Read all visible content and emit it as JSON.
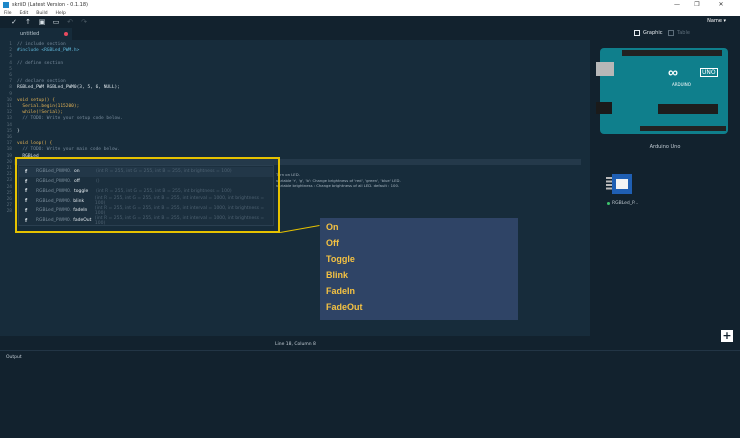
{
  "window": {
    "title": "skriiD (Latest Version - 0.1.18)",
    "controls": [
      "—",
      "❐",
      "✕"
    ]
  },
  "menu": [
    "File",
    "Edit",
    "Build",
    "Help"
  ],
  "toolbar": {
    "icons": [
      "check-icon",
      "upload-icon",
      "save-icon",
      "folder-icon",
      "undo-icon",
      "redo-icon"
    ],
    "name_dropdown": "Name ▾"
  },
  "editor": {
    "tab_label": "untitled",
    "line_numbers": [
      "1",
      "2",
      "3",
      "4",
      "5",
      "6",
      "7",
      "8",
      "9",
      "10",
      "11",
      "12",
      "13",
      "14",
      "15",
      "16",
      "17",
      "18",
      "19",
      "20",
      "21",
      "22",
      "23",
      "24",
      "25",
      "26",
      "27",
      "28"
    ],
    "code_lines": [
      {
        "n": 1,
        "text": "// include section",
        "cls": "c-com"
      },
      {
        "n": 2,
        "text": "#include <RGBLed_PWM.h>",
        "cls": "c-pre"
      },
      {
        "n": 4,
        "text": "// define section",
        "cls": "c-com"
      },
      {
        "n": 7,
        "text": "// declare section",
        "cls": "c-com"
      },
      {
        "n": 8,
        "text": "RGBLed_PWM RGBLed_PWM0(3, 5, 6, NULL);",
        "cls": "c-txt"
      },
      {
        "n": 10,
        "text": "void setup() {",
        "cls": "c-kw"
      },
      {
        "n": 11,
        "text": "  Serial.begin(115200);",
        "cls": "c-fn"
      },
      {
        "n": 12,
        "text": "  while(!Serial);",
        "cls": "c-fn"
      },
      {
        "n": 13,
        "text": "  // TODO: Write your setup code below.",
        "cls": "c-com"
      },
      {
        "n": 15,
        "text": "}",
        "cls": "c-txt"
      },
      {
        "n": 17,
        "text": "void loop() {",
        "cls": "c-kw"
      },
      {
        "n": 18,
        "text": "  // TODO: Write your main code below.",
        "cls": "c-com"
      },
      {
        "n": 19,
        "text": "  RGBLed",
        "cls": "c-txt"
      }
    ]
  },
  "autocomplete": {
    "items": [
      {
        "class": "RGBLed_PWM0.",
        "method": "on",
        "signature": "(int R = 255, int G = 255, int B = 255, int brightness = 100)"
      },
      {
        "class": "RGBLed_PWM0.",
        "method": "off",
        "signature": "()"
      },
      {
        "class": "RGBLed_PWM0.",
        "method": "toggle",
        "signature": "(int R = 255, int G = 255, int B = 255, int brightness = 100)"
      },
      {
        "class": "RGBLed_PWM0.",
        "method": "blink",
        "signature": "(int R = 255, int G = 255, int B = 255, int interval = 1000, int brightness = 100)"
      },
      {
        "class": "RGBLed_PWM0.",
        "method": "fadeIn",
        "signature": "(int R = 255, int G = 255, int B = 255, int interval = 1000, int brightness = 100)"
      },
      {
        "class": "RGBLed_PWM0.",
        "method": "fadeOut",
        "signature": "(int R = 255, int G = 255, int B = 255, int interval = 1000, int brightness = 100)"
      }
    ],
    "hint_lines": [
      "Turn on LED.",
      "variable 'r', 'g', 'b': Change brightness of 'red', 'green', 'blue' LED.",
      "variable brightness : Change brightness of all LED. default : 100."
    ]
  },
  "callout": {
    "items": [
      "On",
      "Off",
      "Toggle",
      "Blink",
      "FadeIn",
      "FadeOut"
    ],
    "color": "#f5c242",
    "background": "#2f4466",
    "frame_color": "#e6c200"
  },
  "status": {
    "cursor": "Line 18, Column 8"
  },
  "output": {
    "label": "Output"
  },
  "side": {
    "tabs": [
      "Graphic",
      "Table"
    ],
    "board_logo": "∞",
    "board_uno": "UNO",
    "board_brand": "ARDUINO",
    "board_name": "Arduino Uno",
    "module_name": "RGBLed_P...",
    "add_label": "+"
  }
}
